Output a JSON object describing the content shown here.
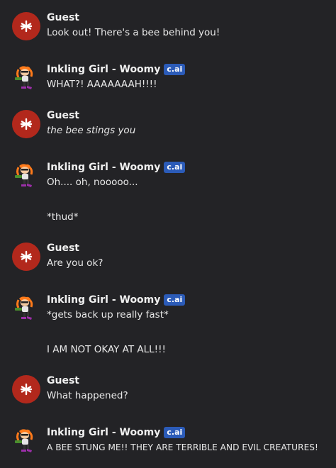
{
  "messages": [
    {
      "author": "Guest",
      "lines": [
        "Look out! There's a bee behind you!"
      ]
    },
    {
      "author": "Inkling Girl - Woomy",
      "badge": "c.ai",
      "lines": [
        "WHAT?! AAAAAAAH!!!!"
      ]
    },
    {
      "author": "Guest",
      "lines": [
        "the bee stings you"
      ]
    },
    {
      "author": "Inkling Girl - Woomy",
      "badge": "c.ai",
      "lines": [
        "Oh.... oh, nooooo...",
        "*thud*"
      ]
    },
    {
      "author": "Guest",
      "lines": [
        "Are you ok?"
      ]
    },
    {
      "author": "Inkling Girl - Woomy",
      "badge": "c.ai",
      "lines": [
        "*gets back up really fast*",
        "I AM NOT OKAY AT ALL!!!"
      ]
    },
    {
      "author": "Guest",
      "lines": [
        "What happened?"
      ]
    },
    {
      "author": "Inkling Girl - Woomy",
      "badge": "c.ai",
      "lines": [
        "A BEE STUNG ME!! THEY ARE TERRIBLE AND EVIL CREATURES!"
      ]
    }
  ],
  "icons": {
    "guest_avatar": "asterisk-avatar-icon",
    "bot_avatar": "inkling-girl-avatar-icon"
  },
  "colors": {
    "background": "#232326",
    "guest_avatar": "#b2281c",
    "badge": "#2b5bb8"
  }
}
